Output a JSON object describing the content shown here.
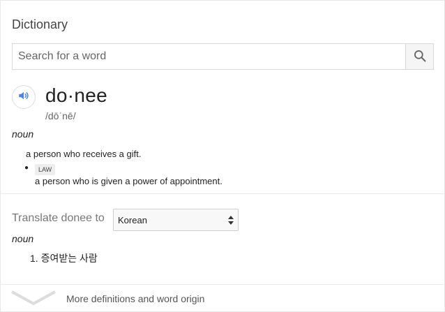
{
  "dictionary": {
    "title": "Dictionary",
    "search": {
      "placeholder": "Search for a word",
      "value": ""
    },
    "entry": {
      "headword": "do·nee",
      "phonetic": "/dōˈnē/",
      "part_of_speech": "noun",
      "definitions": [
        {
          "text": "a person who receives a gift."
        },
        {
          "tag": "LAW",
          "text": "a person who is given a power of appointment."
        }
      ]
    },
    "translate": {
      "label": "Translate donee to",
      "selected_language": "Korean",
      "part_of_speech": "noun",
      "items": [
        "1. 증여받는 사람"
      ]
    },
    "more": {
      "label": "More definitions and word origin"
    }
  },
  "icons": {
    "search": "search-icon",
    "speaker": "speaker-icon",
    "chevron": "chevron-down-icon",
    "select_arrows": "select-arrows-icon"
  },
  "colors": {
    "accent": "#4285f4",
    "text": "#222222",
    "muted": "#777777"
  }
}
